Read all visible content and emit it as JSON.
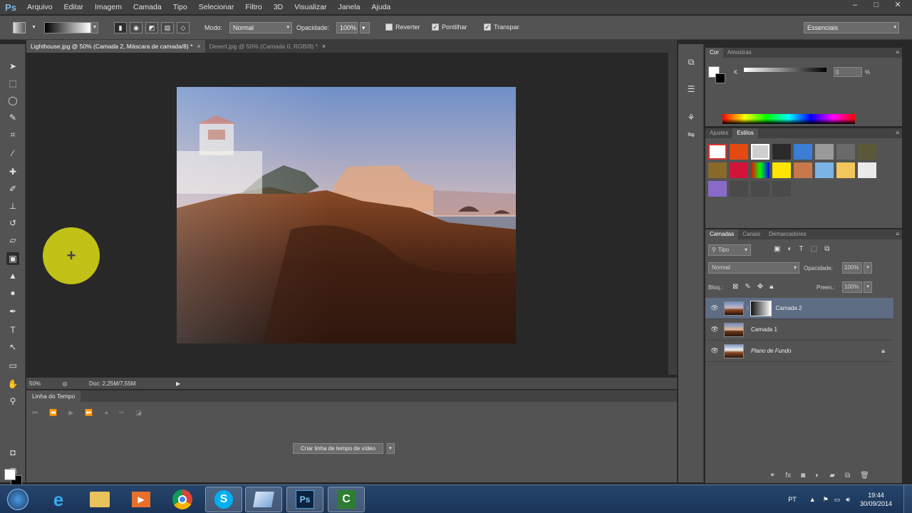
{
  "menu": {
    "logo": "Ps",
    "items": [
      "Arquivo",
      "Editar",
      "Imagem",
      "Camada",
      "Tipo",
      "Selecionar",
      "Filtro",
      "3D",
      "Visualizar",
      "Janela",
      "Ajuda"
    ],
    "window_controls": [
      "–",
      "□",
      "✕"
    ]
  },
  "options": {
    "modo_label": "Modo:",
    "modo_value": "Normal",
    "opacidade_label": "Opacidade:",
    "opacidade_value": "100%",
    "reverter": "Reverter",
    "pontilhar": "Pontilhar",
    "transpar": "Transpar.",
    "workspace": "Essenciais"
  },
  "documents": {
    "tabs": [
      {
        "label": "Lighthouse.jpg @ 50% (Camada 2, Máscara de camada/8) *",
        "close": "×"
      },
      {
        "label": "Desert.jpg @ 50% (Camada 0, RGB/8) *",
        "close": "×"
      }
    ],
    "zoom": "50%",
    "doc_info": "Doc: 2,25M/7,55M"
  },
  "timeline": {
    "title": "Linha do Tempo",
    "create_button": "Criar linha de tempo de vídeo"
  },
  "color_panel": {
    "tabs": [
      "Cor",
      "Amostras"
    ],
    "channel_label": "K",
    "value": "0",
    "unit": "%"
  },
  "styles_panel": {
    "tabs": [
      "Ajustes",
      "Estilos"
    ]
  },
  "layers_panel": {
    "tabs": [
      "Camadas",
      "Canais",
      "Demarcadores"
    ],
    "filter_label": "Tipo",
    "blend_mode": "Normal",
    "opacity_label": "Opacidade:",
    "opacity_value": "100%",
    "lock_label": "Bloq.:",
    "fill_label": "Preen.:",
    "fill_value": "100%",
    "layers": [
      {
        "name": "Camada 2",
        "selected": true,
        "has_mask": true
      },
      {
        "name": "Camada 1",
        "selected": false,
        "has_mask": false
      },
      {
        "name": "Plano de Fundo",
        "selected": false,
        "has_mask": false,
        "italic": true,
        "locked": true
      }
    ]
  },
  "taskbar": {
    "language": "PT",
    "time": "19:44",
    "date": "30/09/2014",
    "apps": [
      "start-button",
      "ie-icon",
      "explorer-icon",
      "media-player-icon",
      "chrome-icon",
      "skype-icon",
      "app-icon",
      "photoshop-icon",
      "camtasia-icon"
    ]
  },
  "accent_colors": {
    "selection": "#5e6c84",
    "cursor_highlight": "#dcdc14"
  }
}
